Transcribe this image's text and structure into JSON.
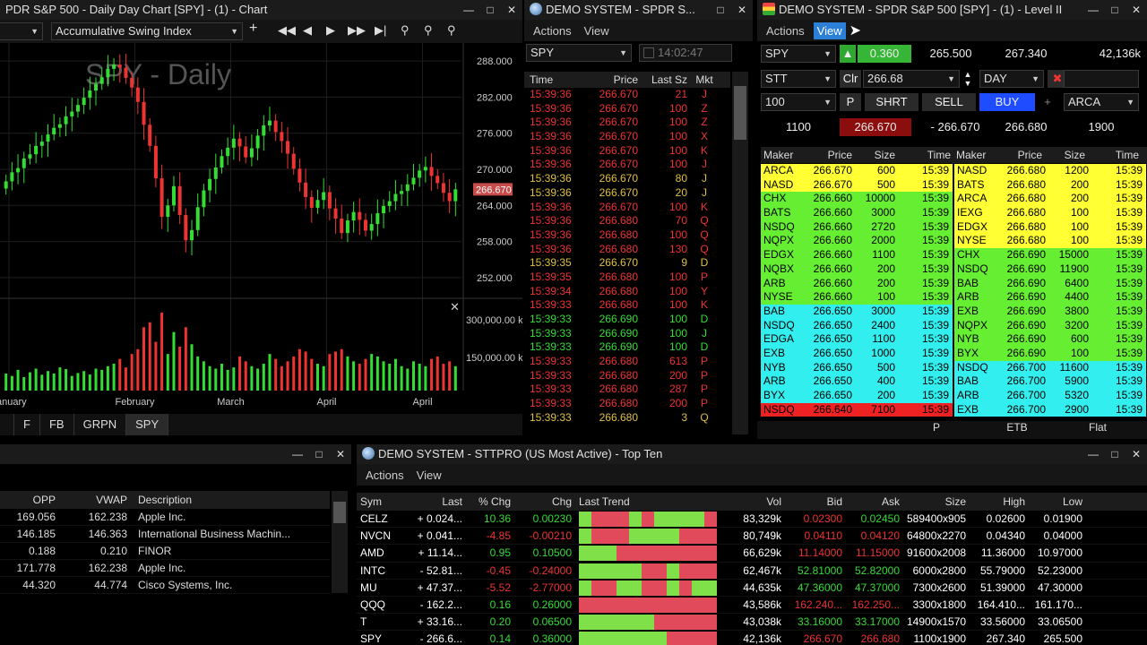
{
  "colors": {
    "up": "#33dd33",
    "down": "#ee3333",
    "yellow": "#ffff33",
    "green": "#66ee33",
    "cyan": "#33eeee",
    "red": "#ee2222",
    "accent": "#2c7fd6"
  },
  "chart_window": {
    "title": "PDR S&P 500 - Daily Day Chart [SPY] - (1) - Chart",
    "indicator": "Accumulative Swing Index",
    "chart_title": "SPY - Daily",
    "price_badge": "266.670",
    "volume_labels": [
      "300,000.00 k",
      "150,000.00 k"
    ],
    "tabs": [
      "F",
      "FB",
      "GRPN",
      "SPY"
    ],
    "selected_tab": "SPY"
  },
  "chart_data": {
    "type": "candlestick",
    "title": "SPY - Daily",
    "x_tick_labels": [
      "January",
      "February",
      "March",
      "April",
      "April"
    ],
    "y_tick_labels": [
      "288.000",
      "282.000",
      "276.000",
      "270.000",
      "264.000",
      "258.000",
      "252.000"
    ],
    "ylim": [
      249,
      291
    ],
    "volume_ylim": [
      0,
      360000
    ],
    "closes": [
      268.0,
      269.5,
      270.2,
      271.8,
      272.5,
      273.9,
      274.6,
      275.8,
      276.9,
      277.5,
      278.8,
      279.6,
      280.7,
      281.9,
      283.1,
      284.2,
      285.3,
      286.7,
      287.4,
      286.9,
      285.2,
      283.6,
      281.2,
      277.4,
      273.9,
      268.5,
      262.1,
      264.0,
      267.2,
      262.4,
      258.2,
      259.9,
      263.7,
      266.5,
      268.4,
      270.3,
      272.2,
      273.6,
      275.1,
      273.8,
      272.0,
      273.5,
      275.6,
      277.3,
      278.1,
      276.2,
      274.7,
      272.6,
      270.1,
      267.8,
      265.4,
      263.6,
      264.9,
      266.2,
      263.5,
      261.8,
      259.4,
      261.5,
      262.9,
      261.6,
      259.8,
      260.9,
      262.7,
      263.9,
      264.7,
      265.9,
      266.4,
      267.5,
      268.6,
      269.8,
      270.4,
      268.9,
      267.7,
      266.1,
      264.7,
      266.67
    ],
    "volumes": [
      70,
      60,
      85,
      55,
      75,
      90,
      65,
      80,
      70,
      95,
      88,
      60,
      72,
      80,
      66,
      90,
      85,
      100,
      110,
      130,
      95,
      150,
      170,
      260,
      280,
      200,
      320,
      150,
      240,
      180,
      260,
      190,
      140,
      120,
      100,
      90,
      110,
      85,
      95,
      140,
      120,
      100,
      90,
      110,
      150,
      130,
      100,
      120,
      140,
      170,
      160,
      130,
      110,
      100,
      150,
      160,
      170,
      140,
      120,
      110,
      130,
      150,
      140,
      120,
      110,
      130,
      100,
      90,
      120,
      110,
      100,
      130,
      140,
      110,
      120,
      100
    ]
  },
  "ts_window": {
    "title": "DEMO SYSTEM - SPDR S...",
    "menu": [
      "Actions",
      "View"
    ],
    "symbol": "SPY",
    "time": "14:02:47",
    "columns": [
      "Time",
      "Price",
      "Last Sz",
      "Mkt"
    ],
    "rows": [
      [
        "15:39:36",
        "266.670",
        "21",
        "J",
        "down"
      ],
      [
        "15:39:36",
        "266.670",
        "100",
        "Z",
        "down"
      ],
      [
        "15:39:36",
        "266.670",
        "100",
        "Z",
        "down"
      ],
      [
        "15:39:36",
        "266.670",
        "100",
        "X",
        "down"
      ],
      [
        "15:39:36",
        "266.670",
        "100",
        "K",
        "down"
      ],
      [
        "15:39:36",
        "266.670",
        "100",
        "J",
        "down"
      ],
      [
        "15:39:36",
        "266.670",
        "80",
        "J",
        "neutral"
      ],
      [
        "15:39:36",
        "266.670",
        "20",
        "J",
        "neutral"
      ],
      [
        "15:39:36",
        "266.670",
        "100",
        "K",
        "down"
      ],
      [
        "15:39:36",
        "266.680",
        "70",
        "Q",
        "down"
      ],
      [
        "15:39:36",
        "266.680",
        "100",
        "Q",
        "down"
      ],
      [
        "15:39:36",
        "266.680",
        "130",
        "Q",
        "down"
      ],
      [
        "15:39:35",
        "266.670",
        "9",
        "D",
        "neutral"
      ],
      [
        "15:39:35",
        "266.680",
        "100",
        "P",
        "down"
      ],
      [
        "15:39:34",
        "266.680",
        "100",
        "Y",
        "down"
      ],
      [
        "15:39:33",
        "266.680",
        "100",
        "K",
        "down"
      ],
      [
        "15:39:33",
        "266.690",
        "100",
        "D",
        "up"
      ],
      [
        "15:39:33",
        "266.690",
        "100",
        "J",
        "up"
      ],
      [
        "15:39:33",
        "266.690",
        "100",
        "D",
        "up"
      ],
      [
        "15:39:33",
        "266.680",
        "613",
        "P",
        "down"
      ],
      [
        "15:39:33",
        "266.680",
        "200",
        "P",
        "down"
      ],
      [
        "15:39:33",
        "266.680",
        "287",
        "P",
        "down"
      ],
      [
        "15:39:33",
        "266.680",
        "200",
        "P",
        "down"
      ],
      [
        "15:39:33",
        "266.680",
        "3",
        "Q",
        "neutral"
      ]
    ]
  },
  "l2_window": {
    "title": "DEMO SYSTEM - SPDR S&P 500 [SPY] - (1) - Level II",
    "menu": [
      "Actions",
      "View"
    ],
    "symbol": "SPY",
    "change": "0.360",
    "last": "265.500",
    "high": "267.340",
    "volume": "42,136k",
    "route": "STT",
    "clr_label": "Clr",
    "price": "266.68",
    "tif": "DAY",
    "quantity": "100",
    "p_label": "P",
    "shrt_label": "SHRT",
    "sell_label": "SELL",
    "buy_label": "BUY",
    "plus_label": "+",
    "exchange": "ARCA",
    "bid_size": "1100",
    "bid": "266.670",
    "spread": "- 266.670",
    "ask": "266.680",
    "ask_size": "1900",
    "columns": [
      "Maker",
      "Price",
      "Size",
      "Time"
    ],
    "bids": [
      [
        "ARCA",
        "266.670",
        "600",
        "15:39",
        "yellow"
      ],
      [
        "NASD",
        "266.670",
        "500",
        "15:39",
        "yellow"
      ],
      [
        "CHX",
        "266.660",
        "10000",
        "15:39",
        "green"
      ],
      [
        "BATS",
        "266.660",
        "3000",
        "15:39",
        "green"
      ],
      [
        "NSDQ",
        "266.660",
        "2720",
        "15:39",
        "green"
      ],
      [
        "NQPX",
        "266.660",
        "2000",
        "15:39",
        "green"
      ],
      [
        "EDGX",
        "266.660",
        "1100",
        "15:39",
        "green"
      ],
      [
        "NQBX",
        "266.660",
        "200",
        "15:39",
        "green"
      ],
      [
        "ARB",
        "266.660",
        "200",
        "15:39",
        "green"
      ],
      [
        "NYSE",
        "266.660",
        "100",
        "15:39",
        "green"
      ],
      [
        "BAB",
        "266.650",
        "3000",
        "15:39",
        "cyan"
      ],
      [
        "NSDQ",
        "266.650",
        "2400",
        "15:39",
        "cyan"
      ],
      [
        "EDGA",
        "266.650",
        "1100",
        "15:39",
        "cyan"
      ],
      [
        "EXB",
        "266.650",
        "1000",
        "15:39",
        "cyan"
      ],
      [
        "NYB",
        "266.650",
        "500",
        "15:39",
        "cyan"
      ],
      [
        "ARB",
        "266.650",
        "400",
        "15:39",
        "cyan"
      ],
      [
        "BYX",
        "266.650",
        "200",
        "15:39",
        "cyan"
      ],
      [
        "NSDQ",
        "266.640",
        "7100",
        "15:39",
        "red"
      ]
    ],
    "asks": [
      [
        "NASD",
        "266.680",
        "1200",
        "15:39",
        "yellow"
      ],
      [
        "BATS",
        "266.680",
        "200",
        "15:39",
        "yellow"
      ],
      [
        "ARCA",
        "266.680",
        "200",
        "15:39",
        "yellow"
      ],
      [
        "IEXG",
        "266.680",
        "100",
        "15:39",
        "yellow"
      ],
      [
        "EDGX",
        "266.680",
        "100",
        "15:39",
        "yellow"
      ],
      [
        "NYSE",
        "266.680",
        "100",
        "15:39",
        "yellow"
      ],
      [
        "CHX",
        "266.690",
        "15000",
        "15:39",
        "green"
      ],
      [
        "NSDQ",
        "266.690",
        "11900",
        "15:39",
        "green"
      ],
      [
        "BAB",
        "266.690",
        "6400",
        "15:39",
        "green"
      ],
      [
        "ARB",
        "266.690",
        "4400",
        "15:39",
        "green"
      ],
      [
        "EXB",
        "266.690",
        "3800",
        "15:39",
        "green"
      ],
      [
        "NQPX",
        "266.690",
        "3200",
        "15:39",
        "green"
      ],
      [
        "NYB",
        "266.690",
        "600",
        "15:39",
        "green"
      ],
      [
        "BYX",
        "266.690",
        "100",
        "15:39",
        "green"
      ],
      [
        "NSDQ",
        "266.700",
        "11600",
        "15:39",
        "cyan"
      ],
      [
        "BAB",
        "266.700",
        "5900",
        "15:39",
        "cyan"
      ],
      [
        "ARB",
        "266.700",
        "5320",
        "15:39",
        "cyan"
      ],
      [
        "EXB",
        "266.700",
        "2900",
        "15:39",
        "cyan"
      ]
    ],
    "footer": [
      "P",
      "ETB",
      "Flat"
    ]
  },
  "bl_window": {
    "columns": [
      "OPP",
      "VWAP",
      "Description"
    ],
    "rows": [
      [
        "169.056",
        "162.238",
        "Apple Inc."
      ],
      [
        "146.185",
        "146.363",
        "International Business Machin..."
      ],
      [
        "0.188",
        "0.210",
        "FINOR"
      ],
      [
        "171.778",
        "162.238",
        "Apple Inc."
      ],
      [
        "44.320",
        "44.774",
        "Cisco Systems, Inc."
      ]
    ]
  },
  "tt_window": {
    "title": "DEMO SYSTEM - STTPRO (US Most Active) - Top Ten",
    "menu": [
      "Actions",
      "View"
    ],
    "columns": [
      "Sym",
      "Last",
      "% Chg",
      "Chg",
      "Last Trend",
      "Vol",
      "Bid",
      "Ask",
      "Size",
      "High",
      "Low"
    ],
    "rows": [
      {
        "sym": "CELZ",
        "last": "+ 0.024...",
        "pct": "10.36",
        "chg": "0.00230",
        "vol": "83,329k",
        "bid": "0.02300",
        "ask": "0.02450",
        "size": "589400x905",
        "high": "0.02600",
        "low": "0.01900",
        "dir": "up",
        "bidc": "down",
        "askc": "up",
        "trend": "GRRRGRGGGGR"
      },
      {
        "sym": "NVCN",
        "last": "+ 0.041...",
        "pct": "-4.85",
        "chg": "-0.00210",
        "vol": "80,749k",
        "bid": "0.04110",
        "ask": "0.04120",
        "size": "64800x2270",
        "high": "0.04340",
        "low": "0.04000",
        "dir": "down",
        "bidc": "down",
        "askc": "down",
        "trend": "GRRRGGGGRRR"
      },
      {
        "sym": "AMD",
        "last": "+ 11.14...",
        "pct": "0.95",
        "chg": "0.10500",
        "vol": "66,629k",
        "bid": "11.14000",
        "ask": "11.15000",
        "size": "91600x2008",
        "high": "11.36000",
        "low": "10.97000",
        "dir": "up",
        "bidc": "down",
        "askc": "down",
        "trend": "GGGRRRRRRRR"
      },
      {
        "sym": "INTC",
        "last": "- 52.81...",
        "pct": "-0.45",
        "chg": "-0.24000",
        "vol": "62,467k",
        "bid": "52.81000",
        "ask": "52.82000",
        "size": "6000x2800",
        "high": "55.79000",
        "low": "52.23000",
        "dir": "down",
        "bidc": "up",
        "askc": "up",
        "trend": "GGGGGRRGRRR"
      },
      {
        "sym": "MU",
        "last": "+ 47.37...",
        "pct": "-5.52",
        "chg": "-2.77000",
        "vol": "44,635k",
        "bid": "47.36000",
        "ask": "47.37000",
        "size": "7300x2600",
        "high": "51.39000",
        "low": "47.30000",
        "dir": "down",
        "bidc": "up",
        "askc": "up",
        "trend": "GRRGGRRGRGG"
      },
      {
        "sym": "QQQ",
        "last": "- 162.2...",
        "pct": "0.16",
        "chg": "0.26000",
        "vol": "43,586k",
        "bid": "162.240...",
        "ask": "162.250...",
        "size": "3300x1800",
        "high": "164.410...",
        "low": "161.170...",
        "dir": "up",
        "bidc": "down",
        "askc": "down",
        "trend": "RRRRRRRRRRR"
      },
      {
        "sym": "T",
        "last": "+ 33.16...",
        "pct": "0.20",
        "chg": "0.06500",
        "vol": "43,038k",
        "bid": "33.16000",
        "ask": "33.17000",
        "size": "14900x1570",
        "high": "33.56000",
        "low": "33.06500",
        "dir": "up",
        "bidc": "up",
        "askc": "up",
        "trend": "GGGGGGRRRRR"
      },
      {
        "sym": "SPY",
        "last": "- 266.6...",
        "pct": "0.14",
        "chg": "0.36000",
        "vol": "42,136k",
        "bid": "266.670",
        "ask": "266.680",
        "size": "1100x1900",
        "high": "267.340",
        "low": "265.500",
        "dir": "up",
        "bidc": "down",
        "askc": "down",
        "trend": "GGGGGGGRRRR"
      }
    ]
  }
}
